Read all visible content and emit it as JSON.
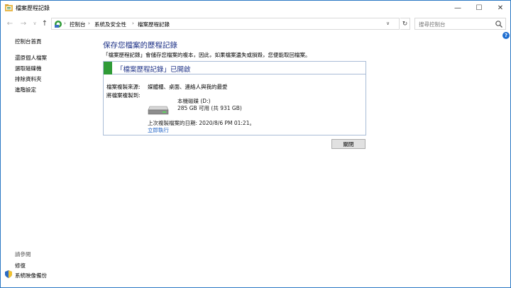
{
  "window": {
    "title": "檔案歷程記錄",
    "controls": {
      "minimize": "—",
      "maximize": "☐",
      "close": "✕"
    }
  },
  "nav": {
    "breadcrumbs": [
      "控制台",
      "系統及安全性",
      "檔案歷程記錄"
    ],
    "search_placeholder": "搜尋控制台"
  },
  "sidebar": {
    "home": "控制台首頁",
    "links": [
      "還原個人檔案",
      "選取磁碟機",
      "排除資料夾",
      "進階設定"
    ],
    "see_also_heading": "請參閱",
    "see_also": [
      "修復",
      "系統映像備份"
    ]
  },
  "main": {
    "title": "保存您檔案的歷程記錄",
    "description": "「檔案歷程記錄」會儲存您檔案的複本，因此，如果檔案遺失或損毀，您便能取回檔案。",
    "status_title": "「檔案歷程記錄」已開啟",
    "source_label": "檔案複製來源:",
    "source_value": "媒體櫃、桌面、連絡人與我的最愛",
    "dest_label": "將檔案複製到:",
    "drive_name": "本機磁碟 (D:)",
    "drive_space": "285 GB 可用 (共 931 GB)",
    "last_copy": "上次複製檔案的日期: 2020/8/6 PM 01:21。",
    "run_now": "立即執行",
    "close_button": "關閉",
    "status_color": "#2f9b37"
  },
  "help": "?"
}
